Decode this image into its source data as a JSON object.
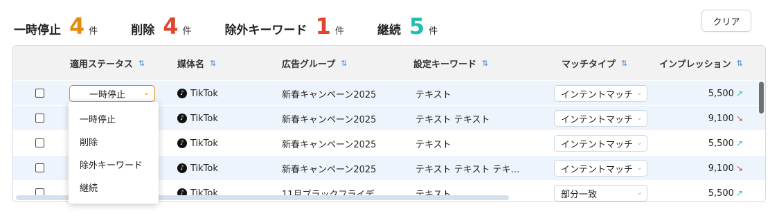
{
  "summary": [
    {
      "label": "一時停止",
      "count": "4",
      "unit": "件",
      "color": "#e58a0c"
    },
    {
      "label": "削除",
      "count": "4",
      "unit": "件",
      "color": "#e0452e"
    },
    {
      "label": "除外キーワード",
      "count": "1",
      "unit": "件",
      "color": "#e0452e"
    },
    {
      "label": "継続",
      "count": "5",
      "unit": "件",
      "color": "#1fbfb0"
    }
  ],
  "clear_label": "クリア",
  "table": {
    "sort_icon": "⇅",
    "columns": [
      "適用ステータス",
      "媒体名",
      "広告グループ",
      "設定キーワード",
      "マッチタイプ",
      "インプレッション"
    ],
    "rows": [
      {
        "status": "一時停止",
        "media": "TikTok",
        "group": "新春キャンペーン2025",
        "keyword": "テキスト",
        "match": "インテントマッチ",
        "impressions": "5,500",
        "trend": "up"
      },
      {
        "media": "TikTok",
        "group": "新春キャンペーン2025",
        "keyword": "テキスト テキスト",
        "match": "インテントマッチ",
        "impressions": "9,100",
        "trend": "down"
      },
      {
        "media": "TikTok",
        "group": "新春キャンペーン2025",
        "keyword": "テキスト",
        "match": "インテントマッチ",
        "impressions": "5,500",
        "trend": "up"
      },
      {
        "media": "TikTok",
        "group": "新春キャンペーン2025",
        "keyword": "テキスト テキスト テキ…",
        "match": "インテントマッチ",
        "impressions": "9,100",
        "trend": "down"
      },
      {
        "media": "TikTok",
        "group": "11月ブラックフライデ",
        "keyword": "テキスト",
        "match": "部分一致",
        "impressions": "5,500",
        "trend": "up"
      }
    ]
  },
  "dropdown": {
    "options": [
      "一時停止",
      "削除",
      "除外キーワード",
      "継続"
    ]
  },
  "icons": {
    "tiktok": "tiktok-icon",
    "chevron": "chevron-down-icon",
    "trend_up": "↗",
    "trend_down": "↘"
  }
}
